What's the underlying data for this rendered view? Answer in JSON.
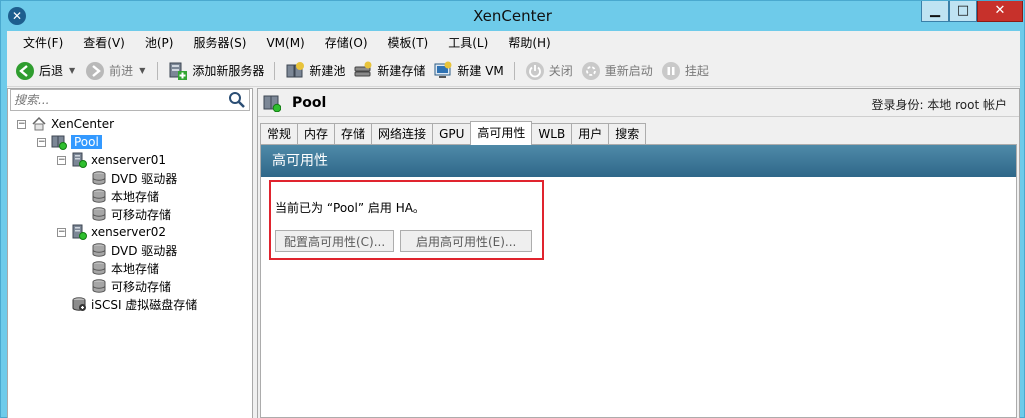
{
  "window": {
    "title": "XenCenter",
    "minimize": "▁",
    "maximize": "□",
    "close": "✕"
  },
  "menu": [
    "文件(F)",
    "查看(V)",
    "池(P)",
    "服务器(S)",
    "VM(M)",
    "存储(O)",
    "模板(T)",
    "工具(L)",
    "帮助(H)"
  ],
  "toolbar": {
    "back": "后退",
    "forward": "前进",
    "add_server": "添加新服务器",
    "new_pool": "新建池",
    "new_storage": "新建存储",
    "new_vm": "新建 VM",
    "shutdown": "关闭",
    "reboot": "重新启动",
    "suspend": "挂起"
  },
  "search": {
    "placeholder": "搜索..."
  },
  "tree": {
    "root": "XenCenter",
    "pool": "Pool",
    "server1": "xenserver01",
    "server1_children": [
      "DVD 驱动器",
      "本地存储",
      "可移动存储"
    ],
    "server2": "xenserver02",
    "server2_children": [
      "DVD 驱动器",
      "本地存储",
      "可移动存储"
    ],
    "iscsi": "iSCSI 虚拟磁盘存储"
  },
  "header": {
    "title": "Pool",
    "login": "登录身份: 本地 root 帐户"
  },
  "tabs": [
    "常规",
    "内存",
    "存储",
    "网络连接",
    "GPU",
    "高可用性",
    "WLB",
    "用户",
    "搜索"
  ],
  "ha": {
    "banner": "高可用性",
    "status": "当前已为 “Pool” 启用 HA。",
    "configure_button": "配置高可用性(C)...",
    "enable_button": "启用高可用性(E)..."
  },
  "colors": {
    "titlebar": "#6ecbea",
    "banner": "#2f6789",
    "selection": "#3399ff",
    "highlight": "#e0242e",
    "close": "#c7312b"
  }
}
